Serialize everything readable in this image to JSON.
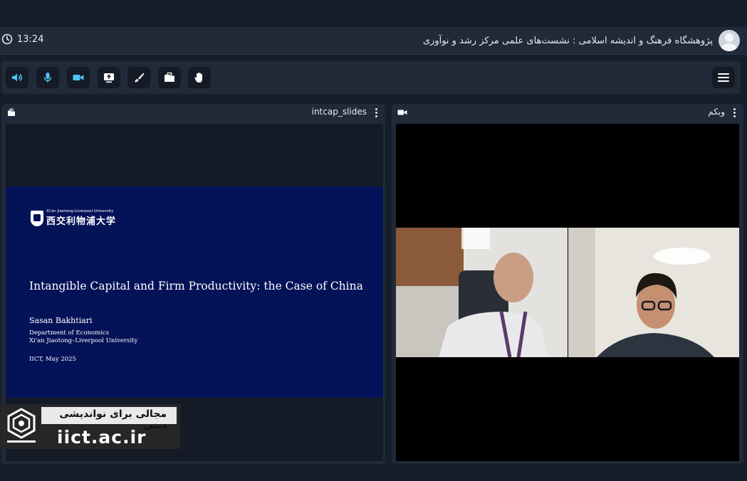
{
  "header": {
    "time": "13:24",
    "session_title": "پژوهشگاه فرهنگ و اندیشه اسلامی : نشست‌های علمی مرکز رشد و نوآوری"
  },
  "toolbar": {
    "buttons": [
      {
        "name": "speaker",
        "icon": "speaker-icon",
        "active": true
      },
      {
        "name": "microphone",
        "icon": "microphone-icon",
        "active": true
      },
      {
        "name": "camera",
        "icon": "camera-icon",
        "active": true
      },
      {
        "name": "screen-share",
        "icon": "screen-share-icon",
        "active": false
      },
      {
        "name": "whiteboard",
        "icon": "brush-icon",
        "active": false
      },
      {
        "name": "files",
        "icon": "folder-icon",
        "active": false
      },
      {
        "name": "raise-hand",
        "icon": "hand-icon",
        "active": false
      }
    ],
    "accent_color": "#4fc3f7"
  },
  "slides_panel": {
    "title": "intcap_slides",
    "slide": {
      "university_en": "Xi'an Jiaotong-Liverpool University",
      "university_cn": "西交利物浦大学",
      "title": "Intangible Capital and Firm Productivity: the Case of China",
      "author": "Sasan Bakhtiari",
      "department": "Department of Economics",
      "institution": "Xi'an Jiaotong–Liverpool University",
      "date": "IICT, May 2025"
    }
  },
  "webcam_panel": {
    "title": "وبکم"
  },
  "watermark": {
    "tagline": "مجالی برای نواندیشی دینی",
    "url": "iict.ac.ir"
  }
}
